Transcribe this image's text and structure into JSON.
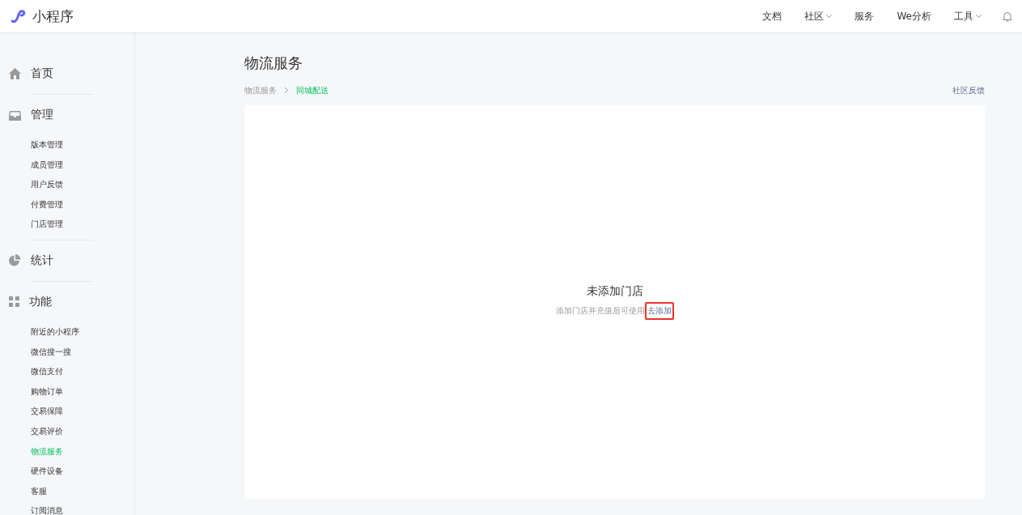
{
  "header": {
    "logo_text": "小程序",
    "nav": [
      {
        "label": "文档",
        "dropdown": false
      },
      {
        "label": "社区",
        "dropdown": true
      },
      {
        "label": "服务",
        "dropdown": false
      },
      {
        "label": "We分析",
        "dropdown": false
      },
      {
        "label": "工具",
        "dropdown": true
      }
    ]
  },
  "sidebar": {
    "groups": [
      {
        "label": "首页"
      },
      {
        "label": "管理",
        "items": [
          {
            "label": "版本管理",
            "selected": false
          },
          {
            "label": "成员管理",
            "selected": false
          },
          {
            "label": "用户反馈",
            "selected": false
          },
          {
            "label": "付费管理",
            "selected": false
          },
          {
            "label": "门店管理",
            "selected": false
          }
        ]
      },
      {
        "label": "统计"
      },
      {
        "label": "功能",
        "items": [
          {
            "label": "附近的小程序",
            "selected": false
          },
          {
            "label": "微信搜一搜",
            "selected": false
          },
          {
            "label": "微信支付",
            "selected": false
          },
          {
            "label": "购物订单",
            "selected": false
          },
          {
            "label": "交易保障",
            "selected": false
          },
          {
            "label": "交易评价",
            "selected": false
          },
          {
            "label": "物流服务",
            "selected": true
          },
          {
            "label": "硬件设备",
            "selected": false
          },
          {
            "label": "客服",
            "selected": false
          },
          {
            "label": "订阅消息",
            "selected": false
          }
        ]
      }
    ]
  },
  "main": {
    "title": "物流服务",
    "breadcrumb": [
      {
        "label": "物流服务",
        "selected": false
      },
      {
        "label": "同城配送",
        "selected": true
      }
    ],
    "feedback_link": "社区反馈",
    "empty_state": {
      "title": "未添加门店",
      "message": "添加门店并充值后可使用",
      "action": "去添加",
      "highlighted": true
    }
  }
}
